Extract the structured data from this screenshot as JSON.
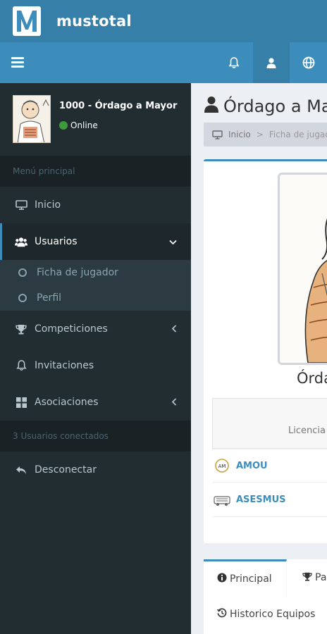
{
  "app": {
    "name": "mustotal"
  },
  "user": {
    "name": "1000 - Órdago a Mayor",
    "status": "Online"
  },
  "sidebar": {
    "header": "Menú principal",
    "items": [
      {
        "label": "Inicio"
      },
      {
        "label": "Usuarios"
      },
      {
        "label": "Competiciones"
      },
      {
        "label": "Invitaciones"
      },
      {
        "label": "Asociaciones"
      },
      {
        "label": "Desconectar"
      }
    ],
    "subitems": [
      {
        "label": "Ficha de jugador"
      },
      {
        "label": "Perfil"
      }
    ],
    "connected": "3 Usuarios conectados"
  },
  "content": {
    "title": "Órdago a Ma",
    "breadcrumb": {
      "home": "Inicio",
      "current": "Ficha de jugador"
    },
    "profile_name": "Órda",
    "licence_label": "Licencia",
    "associations": [
      {
        "name": "AMOU"
      },
      {
        "name": "ASESMUS"
      }
    ],
    "tabs": [
      {
        "label": "Principal"
      },
      {
        "label": "Pa"
      },
      {
        "label": "Historico Equipos"
      }
    ]
  },
  "colors": {
    "header_dark": "#367fa9",
    "header": "#3c8dbc",
    "sidebar": "#222d32",
    "link": "#3c8dbc"
  }
}
